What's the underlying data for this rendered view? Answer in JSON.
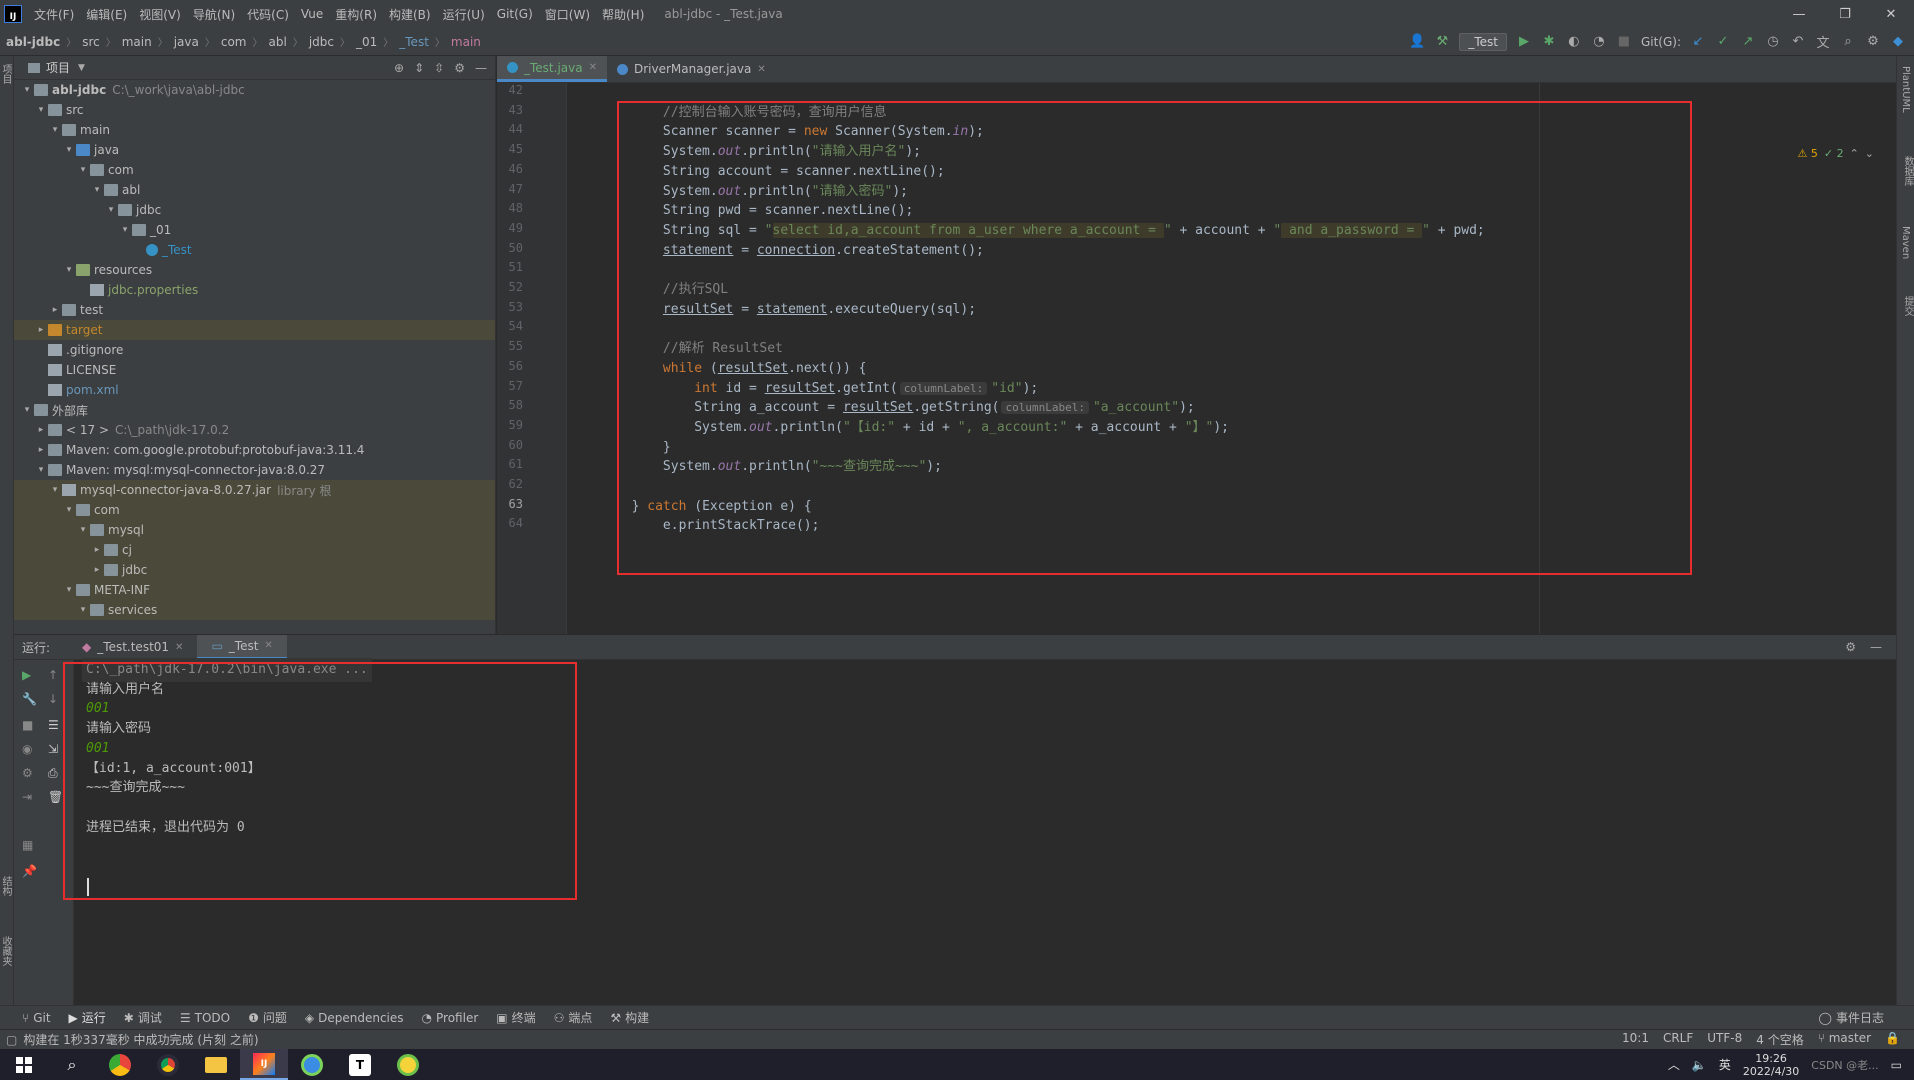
{
  "menubar": {
    "items": [
      "文件(F)",
      "编辑(E)",
      "视图(V)",
      "导航(N)",
      "代码(C)",
      "Vue",
      "重构(R)",
      "构建(B)",
      "运行(U)",
      "Git(G)",
      "窗口(W)",
      "帮助(H)"
    ],
    "window_title": "abl-jdbc - _Test.java",
    "logo_text": "IJ"
  },
  "breadcrumb": [
    "abl-jdbc",
    "src",
    "main",
    "java",
    "com",
    "abl",
    "jdbc",
    "_01",
    "_Test",
    "main"
  ],
  "toolbar": {
    "run_config": "_Test",
    "git_label": "Git(G):"
  },
  "project": {
    "header": "项目",
    "tree": [
      {
        "label": "abl-jdbc",
        "path": "C:\\_work\\java\\abl-jdbc",
        "indent": 0,
        "arrow": "▾",
        "icon": "folder"
      },
      {
        "label": "src",
        "indent": 1,
        "arrow": "▾",
        "icon": "folder"
      },
      {
        "label": "main",
        "indent": 2,
        "arrow": "▾",
        "icon": "folder"
      },
      {
        "label": "java",
        "indent": 3,
        "arrow": "▾",
        "icon": "src"
      },
      {
        "label": "com",
        "indent": 4,
        "arrow": "▾",
        "icon": "folder"
      },
      {
        "label": "abl",
        "indent": 5,
        "arrow": "▾",
        "icon": "folder"
      },
      {
        "label": "jdbc",
        "indent": 6,
        "arrow": "▾",
        "icon": "folder"
      },
      {
        "label": "_01",
        "indent": 7,
        "arrow": "▾",
        "icon": "folder"
      },
      {
        "label": "_Test",
        "indent": 8,
        "arrow": "",
        "icon": "class",
        "color": "#3592c4"
      },
      {
        "label": "resources",
        "indent": 3,
        "arrow": "▾",
        "icon": "res"
      },
      {
        "label": "jdbc.properties",
        "indent": 4,
        "arrow": "",
        "icon": "file",
        "color": "#8aa36c"
      },
      {
        "label": "test",
        "indent": 2,
        "arrow": "▸",
        "icon": "folder"
      },
      {
        "label": "target",
        "indent": 1,
        "arrow": "▸",
        "icon": "orange",
        "color": "#c4872c",
        "highlight": true
      },
      {
        "label": ".gitignore",
        "indent": 1,
        "arrow": "",
        "icon": "file"
      },
      {
        "label": "LICENSE",
        "indent": 1,
        "arrow": "",
        "icon": "file"
      },
      {
        "label": "pom.xml",
        "indent": 1,
        "arrow": "",
        "icon": "file",
        "color": "#6897bb"
      },
      {
        "label": "外部库",
        "indent": 0,
        "arrow": "▾",
        "icon": "folder"
      },
      {
        "label": "< 17 >",
        "path": "C:\\_path\\jdk-17.0.2",
        "indent": 1,
        "arrow": "▸",
        "icon": "folder"
      },
      {
        "label": "Maven: com.google.protobuf:protobuf-java:3.11.4",
        "indent": 1,
        "arrow": "▸",
        "icon": "folder"
      },
      {
        "label": "Maven: mysql:mysql-connector-java:8.0.27",
        "indent": 1,
        "arrow": "▾",
        "icon": "folder"
      },
      {
        "label": "mysql-connector-java-8.0.27.jar",
        "path": "library 根",
        "indent": 2,
        "arrow": "▾",
        "icon": "file",
        "highlight": true
      },
      {
        "label": "com",
        "indent": 3,
        "arrow": "▾",
        "icon": "folder",
        "highlight": true
      },
      {
        "label": "mysql",
        "indent": 4,
        "arrow": "▾",
        "icon": "folder",
        "highlight": true
      },
      {
        "label": "cj",
        "indent": 5,
        "arrow": "▸",
        "icon": "folder",
        "highlight": true
      },
      {
        "label": "jdbc",
        "indent": 5,
        "arrow": "▸",
        "icon": "folder",
        "highlight": true
      },
      {
        "label": "META-INF",
        "indent": 3,
        "arrow": "▾",
        "icon": "folder",
        "highlight": true
      },
      {
        "label": "services",
        "indent": 4,
        "arrow": "▾",
        "icon": "folder",
        "highlight": true
      }
    ]
  },
  "editor": {
    "tabs": [
      {
        "label": "_Test.java",
        "active": true
      },
      {
        "label": "DriverManager.java",
        "active": false
      }
    ],
    "inspections": {
      "warnings": "5",
      "ok": "2"
    },
    "line_numbers": [
      "42",
      "43",
      "44",
      "45",
      "46",
      "47",
      "48",
      "49",
      "50",
      "51",
      "52",
      "53",
      "54",
      "55",
      "56",
      "57",
      "58",
      "59",
      "60",
      "61",
      "62",
      "63",
      "64"
    ],
    "lines": [
      [],
      [
        {
          "t": "            "
        },
        {
          "t": "//控制台输入账号密码，查询用户信息",
          "c": "cm"
        }
      ],
      [
        {
          "t": "            Scanner scanner = "
        },
        {
          "t": "new",
          "c": "kw"
        },
        {
          "t": " Scanner(System."
        },
        {
          "t": "in",
          "c": "fld"
        },
        {
          "t": ");"
        }
      ],
      [
        {
          "t": "            System."
        },
        {
          "t": "out",
          "c": "fld"
        },
        {
          "t": ".println("
        },
        {
          "t": "\"请输入用户名\"",
          "c": "str"
        },
        {
          "t": ");"
        }
      ],
      [
        {
          "t": "            String account = scanner.nextLine();"
        }
      ],
      [
        {
          "t": "            System."
        },
        {
          "t": "out",
          "c": "fld"
        },
        {
          "t": ".println("
        },
        {
          "t": "\"请输入密码\"",
          "c": "str"
        },
        {
          "t": ");"
        }
      ],
      [
        {
          "t": "            String pwd = scanner.nextLine();"
        }
      ],
      [
        {
          "t": "            String sql = "
        },
        {
          "t": "\"",
          "c": "str"
        },
        {
          "t": "select id,a_account from a_user where a_account = ",
          "c": "sql"
        },
        {
          "t": "\"",
          "c": "str"
        },
        {
          "t": " + account + "
        },
        {
          "t": "\"",
          "c": "str"
        },
        {
          "t": " and a_password = ",
          "c": "sql"
        },
        {
          "t": "\"",
          "c": "str"
        },
        {
          "t": " + pwd;"
        }
      ],
      [
        {
          "t": "            "
        },
        {
          "t": "statement",
          "c": "und"
        },
        {
          "t": " = "
        },
        {
          "t": "connection",
          "c": "und"
        },
        {
          "t": ".createStatement();"
        }
      ],
      [],
      [
        {
          "t": "            "
        },
        {
          "t": "//执行SQL",
          "c": "cm"
        }
      ],
      [
        {
          "t": "            "
        },
        {
          "t": "resultSet",
          "c": "und"
        },
        {
          "t": " = "
        },
        {
          "t": "statement",
          "c": "und"
        },
        {
          "t": ".executeQuery(sql);"
        }
      ],
      [],
      [
        {
          "t": "            "
        },
        {
          "t": "//解析 ResultSet",
          "c": "cm"
        }
      ],
      [
        {
          "t": "            "
        },
        {
          "t": "while",
          "c": "kw"
        },
        {
          "t": " ("
        },
        {
          "t": "resultSet",
          "c": "und"
        },
        {
          "t": ".next()) {"
        }
      ],
      [
        {
          "t": "                "
        },
        {
          "t": "int",
          "c": "kw"
        },
        {
          "t": " id = "
        },
        {
          "t": "resultSet",
          "c": "und"
        },
        {
          "t": ".getInt("
        },
        {
          "t": "columnLabel:",
          "c": "hint"
        },
        {
          "t": "\"id\"",
          "c": "str"
        },
        {
          "t": ");"
        }
      ],
      [
        {
          "t": "                String a_account = "
        },
        {
          "t": "resultSet",
          "c": "und"
        },
        {
          "t": ".getString("
        },
        {
          "t": "columnLabel:",
          "c": "hint"
        },
        {
          "t": "\"a_account\"",
          "c": "str"
        },
        {
          "t": ");"
        }
      ],
      [
        {
          "t": "                System."
        },
        {
          "t": "out",
          "c": "fld"
        },
        {
          "t": ".println("
        },
        {
          "t": "\"【id:\"",
          "c": "str"
        },
        {
          "t": " + id + "
        },
        {
          "t": "\", a_account:\"",
          "c": "str"
        },
        {
          "t": " + a_account + "
        },
        {
          "t": "\"】\"",
          "c": "str"
        },
        {
          "t": ");"
        }
      ],
      [
        {
          "t": "            }"
        }
      ],
      [
        {
          "t": "            System."
        },
        {
          "t": "out",
          "c": "fld"
        },
        {
          "t": ".println("
        },
        {
          "t": "\"~~~查询完成~~~\"",
          "c": "str"
        },
        {
          "t": ");"
        }
      ],
      [],
      [
        {
          "t": "        } "
        },
        {
          "t": "catch",
          "c": "kw"
        },
        {
          "t": " (Exception e) {"
        }
      ],
      [
        {
          "t": "            e.printStackTrace();"
        }
      ]
    ]
  },
  "run": {
    "label": "运行:",
    "tabs": [
      {
        "label": "_Test.test01",
        "active": false
      },
      {
        "label": "_Test",
        "active": true
      }
    ],
    "console": [
      {
        "text": "C:\\_path\\jdk-17.0.2\\bin\\java.exe ...",
        "type": "cmd"
      },
      {
        "text": "请输入用户名",
        "type": "out"
      },
      {
        "text": "001",
        "type": "in"
      },
      {
        "text": "请输入密码",
        "type": "out"
      },
      {
        "text": "001",
        "type": "in"
      },
      {
        "text": "【id:1, a_account:001】",
        "type": "out"
      },
      {
        "text": "~~~查询完成~~~",
        "type": "out"
      },
      {
        "text": "",
        "type": "out"
      },
      {
        "text": "进程已结束，退出代码为 0",
        "type": "out"
      }
    ]
  },
  "leftstrip": {
    "project": "项目",
    "structure": "结构",
    "bookmarks": "收藏夹"
  },
  "rightstrip": {
    "plantuml": "PlantUML",
    "database": "数据库",
    "maven": "Maven",
    "commit": "提交"
  },
  "bottomtools": [
    {
      "label": "Git",
      "icon": "⑂"
    },
    {
      "label": "运行",
      "icon": "▶",
      "active": true
    },
    {
      "label": "调试",
      "icon": "✱"
    },
    {
      "label": "TODO",
      "icon": "☰"
    },
    {
      "label": "问题",
      "icon": "❶"
    },
    {
      "label": "Dependencies",
      "icon": "◈"
    },
    {
      "label": "Profiler",
      "icon": "◔"
    },
    {
      "label": "终端",
      "icon": "▣"
    },
    {
      "label": "端点",
      "icon": "⚇"
    },
    {
      "label": "构建",
      "icon": "⚒"
    }
  ],
  "event_log": "事件日志",
  "status": {
    "message": "构建在 1秒337毫秒 中成功完成 (片刻 之前)",
    "position": "10:1",
    "line_sep": "CRLF",
    "encoding": "UTF-8",
    "indent": "4 个空格",
    "branch": "master"
  },
  "taskbar": {
    "ime": "英",
    "time": "19:26",
    "date": "2022/4/30",
    "watermark": "CSDN @老..."
  }
}
